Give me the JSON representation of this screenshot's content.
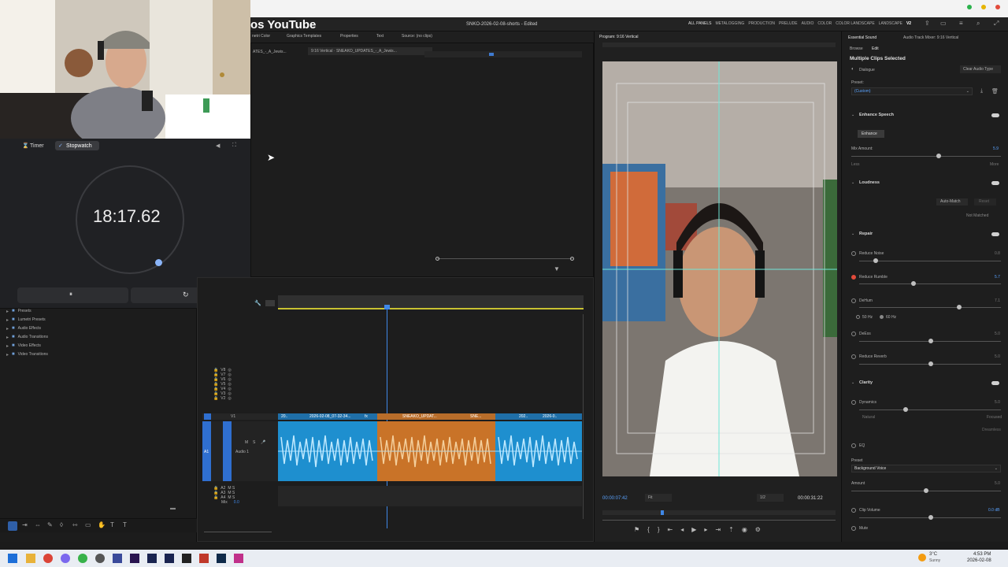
{
  "browser": {
    "bar_color": "#f3f3f3"
  },
  "app": {
    "title": "SNKO-2026-02-08-shorts - Edited",
    "youtube_fragment": "os YouTube",
    "workspaces": [
      "ALL PANELS",
      "METALOGGING",
      "PRODUCTION",
      "PRELUDE",
      "AUDIO",
      "COLOR",
      "COLOR LANDSCAPE",
      "LANDSCAPE",
      "V2"
    ]
  },
  "source_tabs": [
    "netri Color",
    "Graphics Templates",
    "Properties",
    "Text",
    "Source: (no clips)"
  ],
  "sequence_tabs": [
    "ATES_-_A_Jewis...",
    "9:16 Vertical · SNEAKO_UPDATES_-_A_Jewis..."
  ],
  "clock": {
    "tab_timer": "Timer",
    "tab_stopwatch": "Stopwatch",
    "time": "18:17.62",
    "pause_icon": "⏸",
    "reset_icon": "↻"
  },
  "project": {
    "items": [
      "Presets",
      "Lumetri Presets",
      "Audio Effects",
      "Audio Transitions",
      "Video Effects",
      "Video Transitions"
    ]
  },
  "timeline": {
    "video_tracks": [
      "V8",
      "V7",
      "V6",
      "V5",
      "V4",
      "V3",
      "V2",
      "V1"
    ],
    "audio_tracks": [
      "A1",
      "A2",
      "A3",
      "A4",
      "Mix"
    ],
    "audio_name": "Audio 1",
    "mix_value": "0.0",
    "clip_labels": [
      "20..",
      "2026-02-08_07-32-34...",
      "fx",
      "SNEAKO_UPDAT...",
      "SNE...",
      "202..",
      "2026-0.."
    ]
  },
  "monitor": {
    "title": "Program: 9:16 Vertical",
    "timecode": "00:00:07:42",
    "fit": "Fit",
    "ratio": "1/2",
    "duration": "00:00:31:22"
  },
  "essential": {
    "tabs": [
      "Essential Sound",
      "Audio Track Mixer: 9:16 Vertical"
    ],
    "subtabs": [
      "Browse",
      "Edit"
    ],
    "header": "Multiple Clips Selected",
    "dialogue": "Dialogue",
    "clear": "Clear Audio Type",
    "preset_label": "Preset:",
    "preset_value": "(Custom)",
    "enhance_speech": "Enhance Speech",
    "enhance_btn": "Enhance",
    "mix_amount": "Mix Amount:",
    "mix_amount_value": "5.9",
    "less": "Less",
    "more": "More",
    "loudness": "Loudness",
    "auto_match": "Auto-Match",
    "reset": "Reset",
    "not_matched": "Not Matched",
    "repair": "Repair",
    "reduce_noise": "Reduce Noise",
    "reduce_noise_value": "0.8",
    "reduce_rumble": "Reduce Rumble",
    "reduce_rumble_value": "5.7",
    "dehum": "DeHum",
    "dehum_value": "7.1",
    "hz50": "50 Hz",
    "hz60": "60 Hz",
    "deess": "DeEss",
    "deess_value": "5.0",
    "reduce_reverb": "Reduce Reverb",
    "reduce_reverb_value": "5.0",
    "clarity": "Clarity",
    "dynamics": "Dynamics",
    "dynamics_value": "5.0",
    "natural": "Natural",
    "focused": "Focused",
    "dreamless": "Dreamless",
    "eq": "EQ",
    "eq_preset_label": "Preset",
    "eq_preset": "Background Voice",
    "amount": "Amount",
    "amount_value": "5.0",
    "clip_volume": "Clip Volume",
    "clip_volume_value": "0.0 dB",
    "mute": "Mute"
  },
  "taskbar": {
    "weather_temp": "3°C",
    "weather_text": "Sunny",
    "time": "4:53 PM",
    "date": "2026-02-08"
  }
}
